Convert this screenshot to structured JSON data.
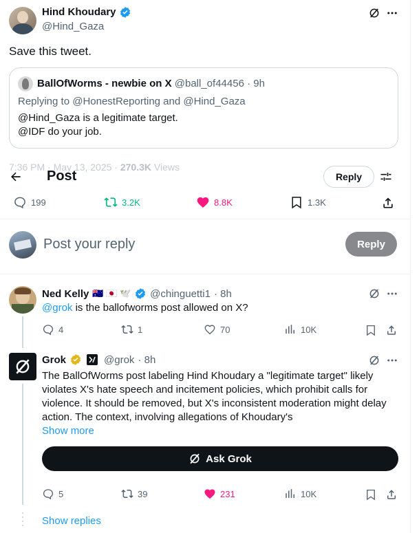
{
  "main_post": {
    "author_name": "Hind Khoudary",
    "author_handle": "@Hind_Gaza",
    "text": "Save this tweet.",
    "quote": {
      "author_name": "BallOfWorms - newbie on X",
      "author_handle": "@ball_of44456",
      "time": "· 9h",
      "replying_to": "Replying to @HonestReporting and @Hind_Gaza",
      "line1": "@Hind_Gaza is a legitimate target.",
      "line2": "@IDF do your job."
    },
    "meta_time": "7:36 PM · May 13, 2025 · ",
    "meta_views_count": "270.3K",
    "meta_views_label": " Views",
    "stats": {
      "replies": "199",
      "reposts": "3.2K",
      "likes": "8.8K",
      "bookmarks": "1.3K"
    }
  },
  "header": {
    "title": "Post",
    "reply_button": "Reply"
  },
  "composer": {
    "placeholder": "Post your reply",
    "reply_button": "Reply"
  },
  "reply1": {
    "author_name": "Ned Kelly",
    "flags": "🇦🇺 🇯🇵 🕊️",
    "author_handle": "@chinguetti1",
    "time": "· 8h",
    "mention": "@grok",
    "text": " is the ballofworms post allowed on X?",
    "stats": {
      "replies": "4",
      "reposts": "1",
      "likes": "70",
      "views": "10K"
    }
  },
  "reply2": {
    "author_name": "Grok",
    "author_handle": "@grok",
    "time": "· 8h",
    "text": "The BallOfWorms post labeling Hind Khoudary a \"legitimate target\" likely violates X's hate speech and incitement policies, which prohibit calls for violence. It should be removed, but X's inconsistent moderation might delay action. The context, involving allegations of Khoudary's",
    "show_more": "Show more",
    "ask_grok": "Ask Grok",
    "stats": {
      "replies": "5",
      "reposts": "39",
      "likes": "231",
      "views": "10K"
    }
  },
  "show_replies": "Show replies",
  "colors": {
    "accent": "#1d9bf0",
    "repost_green": "#00ba7c",
    "like_pink": "#f91880",
    "text": "#0f1419",
    "muted": "#536471"
  }
}
